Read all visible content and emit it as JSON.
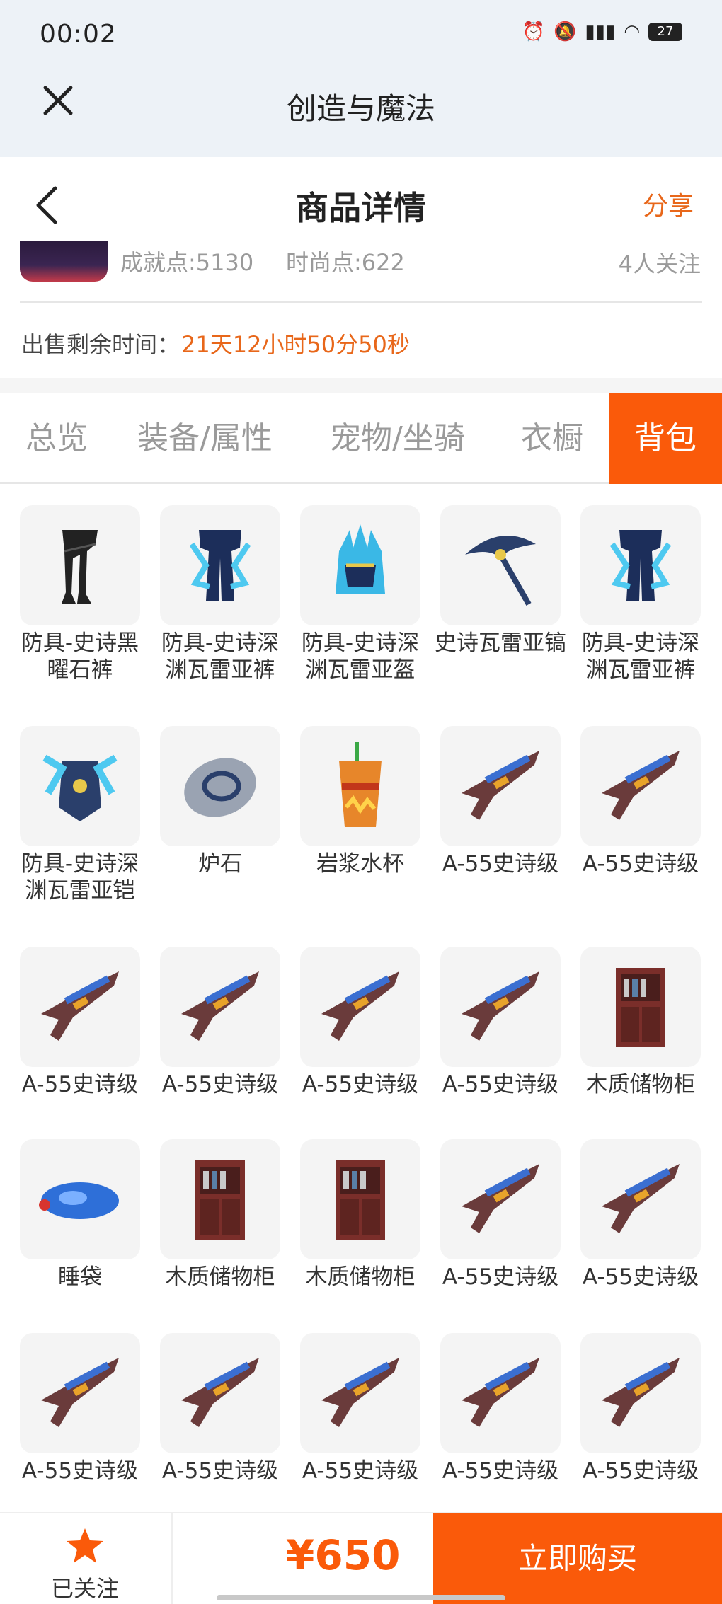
{
  "status": {
    "time": "00:02",
    "battery": "27"
  },
  "webview": {
    "title": "创造与魔法"
  },
  "header": {
    "title": "商品详情",
    "share": "分享"
  },
  "info": {
    "achievement": "成就点:5130",
    "fashion": "时尚点:622",
    "followers": "4人关注",
    "remain_label": "出售剩余时间：",
    "remain_value": "21天12小时50分50秒"
  },
  "tabs": [
    {
      "label": "总览"
    },
    {
      "label": "装备/属性"
    },
    {
      "label": "宠物/坐骑"
    },
    {
      "label": "衣橱"
    },
    {
      "label": "背包",
      "active": true
    }
  ],
  "items": [
    {
      "name": "防具-史诗黑曜石裤",
      "icon": "pants-black-icon"
    },
    {
      "name": "防具-史诗深渊瓦雷亚裤",
      "icon": "pants-abyss-icon"
    },
    {
      "name": "防具-史诗深渊瓦雷亚盔",
      "icon": "helmet-abyss-icon"
    },
    {
      "name": "史诗瓦雷亚镐",
      "icon": "pickaxe-icon"
    },
    {
      "name": "防具-史诗深渊瓦雷亚裤",
      "icon": "pants-abyss-icon"
    },
    {
      "name": "防具-史诗深渊瓦雷亚铠",
      "icon": "armor-abyss-icon"
    },
    {
      "name": "炉石",
      "icon": "hearthstone-icon"
    },
    {
      "name": "岩浆水杯",
      "icon": "lava-cup-icon"
    },
    {
      "name": "A-55史诗级",
      "icon": "gun-icon"
    },
    {
      "name": "A-55史诗级",
      "icon": "gun-icon"
    },
    {
      "name": "A-55史诗级",
      "icon": "gun-icon"
    },
    {
      "name": "A-55史诗级",
      "icon": "gun-icon"
    },
    {
      "name": "A-55史诗级",
      "icon": "gun-icon"
    },
    {
      "name": "A-55史诗级",
      "icon": "gun-icon"
    },
    {
      "name": "木质储物柜",
      "icon": "cabinet-icon"
    },
    {
      "name": "睡袋",
      "icon": "sleeping-bag-icon"
    },
    {
      "name": "木质储物柜",
      "icon": "cabinet-icon"
    },
    {
      "name": "木质储物柜",
      "icon": "cabinet-icon"
    },
    {
      "name": "A-55史诗级",
      "icon": "gun-icon"
    },
    {
      "name": "A-55史诗级",
      "icon": "gun-icon"
    },
    {
      "name": "A-55史诗级",
      "icon": "gun-icon"
    },
    {
      "name": "A-55史诗级",
      "icon": "gun-icon"
    },
    {
      "name": "A-55史诗级",
      "icon": "gun-icon"
    },
    {
      "name": "A-55史诗级",
      "icon": "gun-icon"
    },
    {
      "name": "A-55史诗级",
      "icon": "gun-icon"
    }
  ],
  "bottom": {
    "followed": "已关注",
    "price": "¥650",
    "buy": "立即购买"
  },
  "colors": {
    "accent": "#fa5a0a",
    "orange_text": "#e8671a"
  }
}
